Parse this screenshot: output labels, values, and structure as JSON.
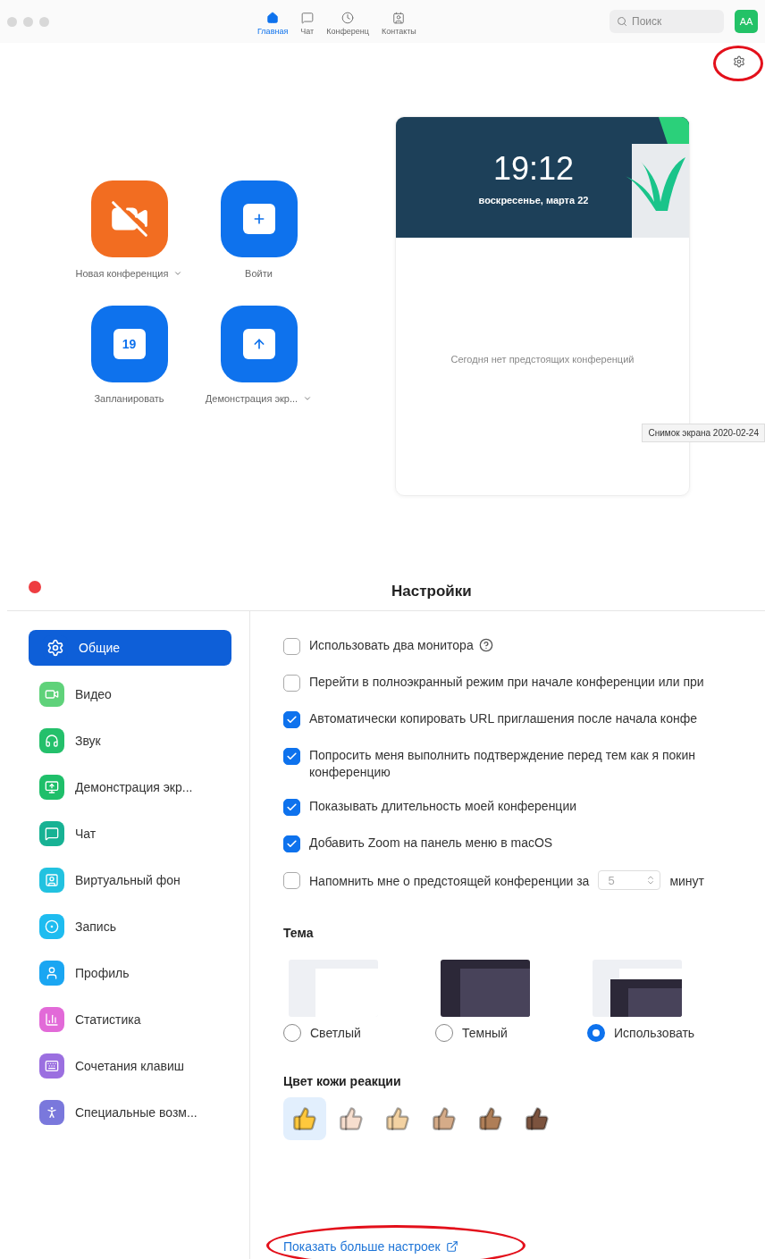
{
  "home": {
    "nav_tabs": [
      {
        "label": "Главная",
        "kind": "home",
        "selected": true
      },
      {
        "label": "Чат",
        "kind": "chat",
        "selected": false
      },
      {
        "label": "Конференц",
        "kind": "clock",
        "selected": false
      },
      {
        "label": "Контакты",
        "kind": "contact",
        "selected": false
      }
    ],
    "search": {
      "placeholder": "Поиск"
    },
    "avatar": {
      "initials": "AA"
    },
    "actions": [
      {
        "label": "Новая конференция",
        "kind": "video-off",
        "color": "#f26d21",
        "dropdown": true
      },
      {
        "label": "Войти",
        "kind": "plus",
        "color": "#0e72ed",
        "dropdown": false
      },
      {
        "label": "Запланировать",
        "kind": "calendar",
        "color": "#0e72ed",
        "dropdown": false,
        "badge": "19"
      },
      {
        "label": "Демонстрация экр...",
        "kind": "share",
        "color": "#0e72ed",
        "dropdown": true
      }
    ],
    "clock": {
      "time": "19:12",
      "date": "воскресенье, марта 22"
    },
    "empty_message": "Сегодня нет предстоящих конференций",
    "tooltip": "Снимок экрана 2020-02-24"
  },
  "settings": {
    "title": "Настройки",
    "sidebar": [
      {
        "label": "Общие",
        "kind": "gear",
        "color": "#0e5fd8",
        "selected": true
      },
      {
        "label": "Видео",
        "kind": "video",
        "color": "#5fd27a",
        "selected": false
      },
      {
        "label": "Звук",
        "kind": "headphones",
        "color": "#24c06b",
        "selected": false
      },
      {
        "label": "Демонстрация экр...",
        "kind": "share",
        "color": "#1fbf6a",
        "selected": false
      },
      {
        "label": "Чат",
        "kind": "chat",
        "color": "#17b294",
        "selected": false
      },
      {
        "label": "Виртуальный фон",
        "kind": "person",
        "color": "#22c2e0",
        "selected": false
      },
      {
        "label": "Запись",
        "kind": "record",
        "color": "#1ebcf0",
        "selected": false
      },
      {
        "label": "Профиль",
        "kind": "profile",
        "color": "#1aa6f2",
        "selected": false
      },
      {
        "label": "Статистика",
        "kind": "stats",
        "color": "#e26ad8",
        "selected": false
      },
      {
        "label": "Сочетания клавиш",
        "kind": "keyboard",
        "color": "#9b6fe0",
        "selected": false
      },
      {
        "label": "Специальные возм...",
        "kind": "accessibility",
        "color": "#7a78dc",
        "selected": false
      }
    ],
    "options": [
      {
        "kind": "plain",
        "label": "Использовать два монитора",
        "checked": false,
        "help": true
      },
      {
        "kind": "plain",
        "label": "Перейти в полноэкранный режим при начале конференции или при",
        "checked": false,
        "help": false
      },
      {
        "kind": "plain",
        "label": "Автоматически копировать URL приглашения после начала конфе",
        "checked": true,
        "help": false
      },
      {
        "kind": "plain",
        "label": "Попросить меня выполнить подтверждение перед тем как я покин",
        "continuation": "конференцию",
        "checked": true,
        "help": false
      },
      {
        "kind": "plain",
        "label": "Показывать длительность моей конференции",
        "checked": true,
        "help": false
      },
      {
        "kind": "plain",
        "label": "Добавить Zoom на панель меню в macOS",
        "checked": true,
        "help": false
      },
      {
        "kind": "reminder",
        "label": "Напомнить мне о предстоящей конференции за",
        "value": "5",
        "suffix": "минут",
        "checked": false,
        "help": false
      }
    ],
    "theme": {
      "title": "Тема",
      "options": [
        {
          "label": "Светлый",
          "kind": "light",
          "selected": false
        },
        {
          "label": "Темный",
          "kind": "dark",
          "selected": false
        },
        {
          "label": "Использовать",
          "kind": "system",
          "selected": true
        }
      ]
    },
    "reactions": {
      "title": "Цвет кожи реакции",
      "tones": [
        {
          "color": "#ffc83d",
          "selected": true
        },
        {
          "color": "#f7dece",
          "selected": false
        },
        {
          "color": "#f3d2a2",
          "selected": false
        },
        {
          "color": "#d5ab88",
          "selected": false
        },
        {
          "color": "#af7e57",
          "selected": false
        },
        {
          "color": "#7c533e",
          "selected": false
        }
      ]
    },
    "more_link": "Показать больше настроек"
  }
}
